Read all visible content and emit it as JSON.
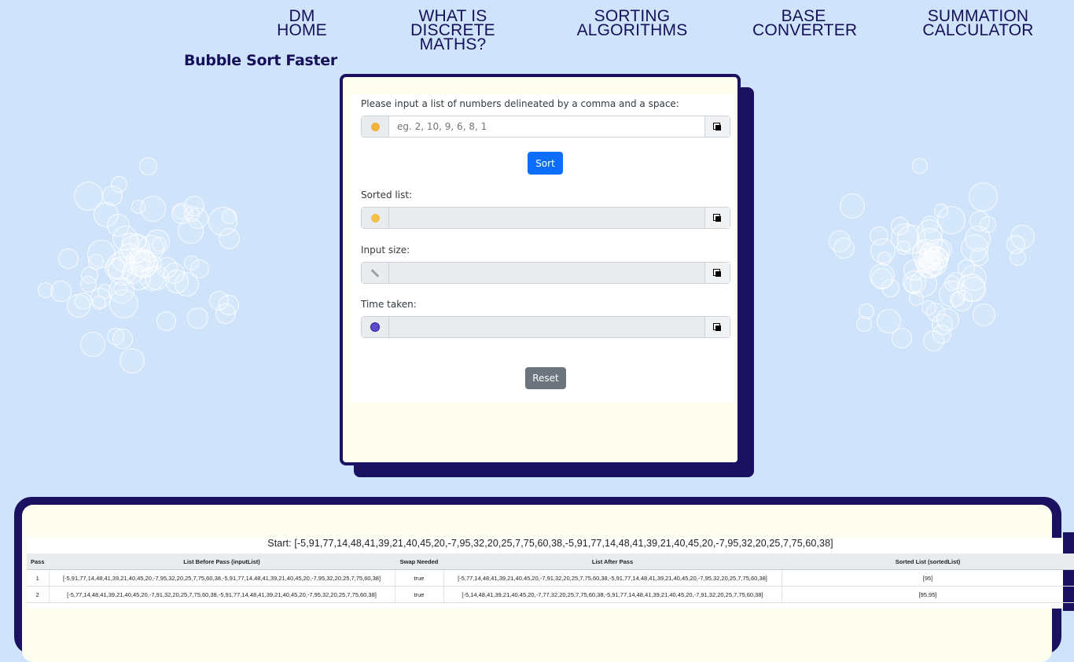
{
  "nav": {
    "items": [
      {
        "line1": "DM",
        "line2": "HOME"
      },
      {
        "line1": "WHAT IS",
        "line2": "DISCRETE MATHS?"
      },
      {
        "line1": "SORTING ALGORITHMS",
        "line2": ""
      },
      {
        "line1": "BASE",
        "line2": "CONVERTER"
      },
      {
        "line1": "SUMMATION",
        "line2": "CALCULATOR"
      }
    ]
  },
  "page": {
    "title": "Bubble Sort Faster"
  },
  "form": {
    "input_label": "Please input a list of numbers delineated by a comma and a space:",
    "input_placeholder": "eg. 2, 10, 9, 6, 8, 1",
    "input_value": "",
    "sort_label": "Sort",
    "sorted_label": "Sorted list:",
    "sorted_value": "",
    "size_label": "Input size:",
    "size_value": "",
    "time_label": "Time taken:",
    "time_value": "",
    "reset_label": "Reset"
  },
  "icons": {
    "input_prefix": "upside-down-face-icon",
    "sorted_prefix": "slightly-smiling-face-icon",
    "size_prefix": "pencil-icon",
    "time_prefix": "stopwatch-icon",
    "copy": "copy-icon"
  },
  "results": {
    "start_text": "Start: [-5,91,77,14,48,41,39,21,40,45,20,-7,95,32,20,25,7,75,60,38,-5,91,77,14,48,41,39,21,40,45,20,-7,95,32,20,25,7,75,60,38]",
    "columns": [
      "Pass",
      "List Before Pass (inputList)",
      "Swap Needed",
      "List After Pass",
      "Sorted List (sortedList)"
    ],
    "rows": [
      {
        "pass": "1",
        "before": "[-5,91,77,14,48,41,39,21,40,45,20,-7,95,32,20,25,7,75,60,38,-5,91,77,14,48,41,39,21,40,45,20,-7,95,32,20,25,7,75,60,38]",
        "swap": "true",
        "after": "[-5,77,14,48,41,39,21,40,45,20,-7,91,32,20,25,7,75,60,38,-5,91,77,14,48,41,39,21,40,45,20,-7,95,32,20,25,7,75,60,38]",
        "sorted": "[95]"
      },
      {
        "pass": "2",
        "before": "[-5,77,14,48,41,39,21,40,45,20,-7,91,32,20,25,7,75,60,38,-5,91,77,14,48,41,39,21,40,45,20,-7,95,32,20,25,7,75,60,38]",
        "swap": "true",
        "after": "[-5,14,48,41,39,21,40,45,20,-7,77,32,20,25,7,75,60,38,-5,91,77,14,48,41,39,21,40,45,20,-7,91,32,20,25,7,75,60,38]",
        "sorted": "[95,95]"
      }
    ]
  },
  "colors": {
    "background": "#cfe4fb",
    "navy": "#1a1160",
    "primary": "#0d6efd",
    "secondary": "#6c757d",
    "card": "#fdfdf0"
  }
}
